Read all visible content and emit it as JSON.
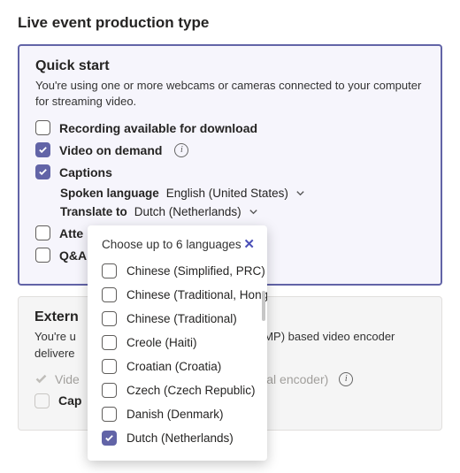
{
  "sectionTitle": "Live event production type",
  "primary": {
    "title": "Quick start",
    "desc": "You're using one or more webcams or cameras connected to your computer for streaming video.",
    "opt1": "Recording available for download",
    "opt2": "Video on demand",
    "opt3": "Captions",
    "spokenKey": "Spoken language",
    "spokenVal": "English (United States)",
    "translateKey": "Translate to",
    "translateVal": "Dutch (Netherlands)",
    "opt4": "Atte",
    "opt5": "Q&A"
  },
  "secondary": {
    "title": "Extern",
    "descA": "You're u",
    "descB": "ol (RTMP) based video encoder",
    "descC": "delivere",
    "row1a": "Vide",
    "row1b": "External encoder)",
    "row2": "Cap"
  },
  "dropdown": {
    "title": "Choose up to 6 languages",
    "items": [
      {
        "label": "Chinese (Simplified, PRC)",
        "checked": false
      },
      {
        "label": "Chinese (Traditional, Hong Ko",
        "checked": false
      },
      {
        "label": "Chinese (Traditional)",
        "checked": false
      },
      {
        "label": "Creole (Haiti)",
        "checked": false
      },
      {
        "label": "Croatian (Croatia)",
        "checked": false
      },
      {
        "label": "Czech (Czech Republic)",
        "checked": false
      },
      {
        "label": "Danish (Denmark)",
        "checked": false
      },
      {
        "label": "Dutch (Netherlands)",
        "checked": true
      }
    ]
  }
}
